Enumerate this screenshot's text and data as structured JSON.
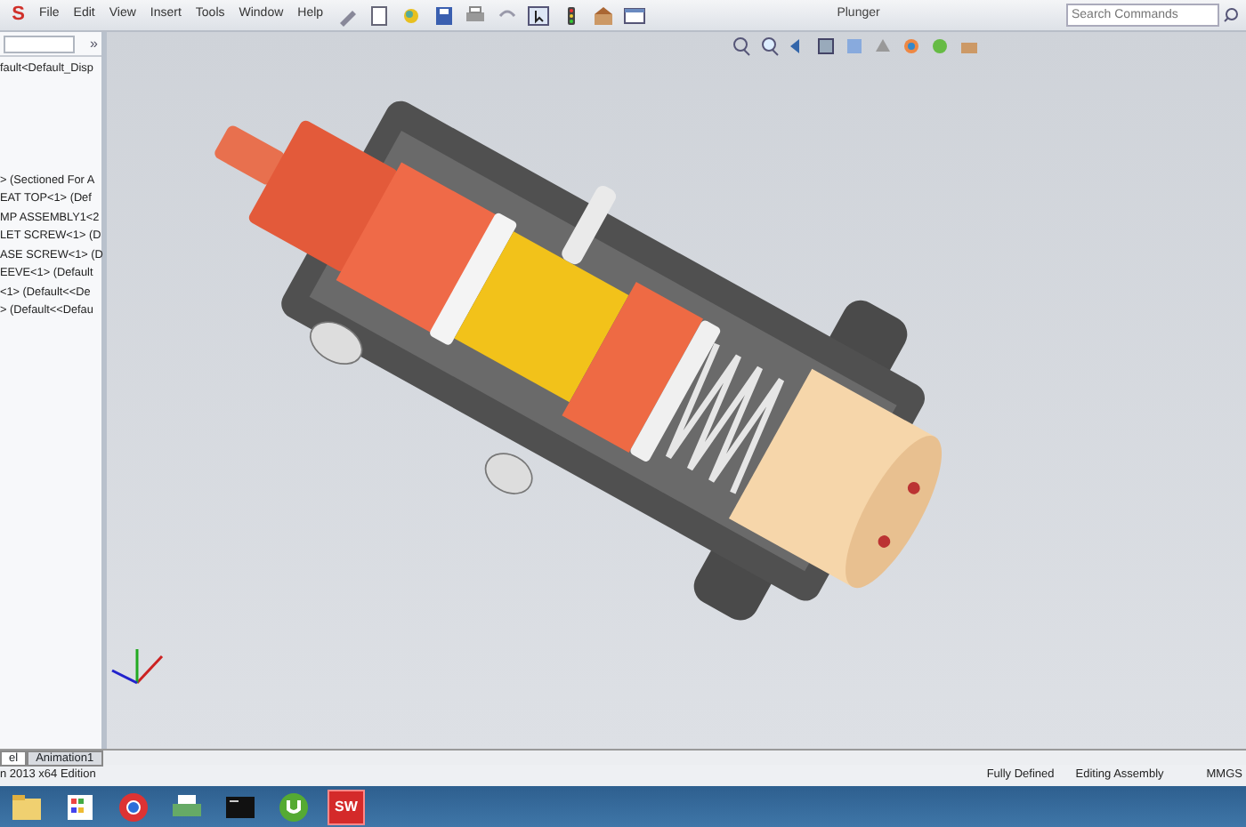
{
  "app_logo": "S",
  "menu": [
    "File",
    "Edit",
    "View",
    "Insert",
    "Tools",
    "Window",
    "Help"
  ],
  "title": "Plunger",
  "search": {
    "placeholder": "Search Commands"
  },
  "panel": {
    "expand_label": "»",
    "items": [
      "fault<Default_Disp",
      "> (Sectioned For A",
      "EAT TOP<1> (Def",
      "MP ASSEMBLY1<2",
      "LET SCREW<1> (D",
      "ASE SCREW<1> (D",
      "EEVE<1> (Default",
      "<1> (Default<<De",
      "> (Default<<Defau"
    ]
  },
  "bottom_tabs": [
    {
      "label": "el",
      "selected": true
    },
    {
      "label": "Animation1",
      "selected": false
    }
  ],
  "status_bar": {
    "edition": "n 2013 x64 Edition",
    "state": "Fully Defined",
    "mode": "Editing Assembly",
    "units": "MMGS"
  },
  "taskbar": {
    "app_label": "SW"
  }
}
